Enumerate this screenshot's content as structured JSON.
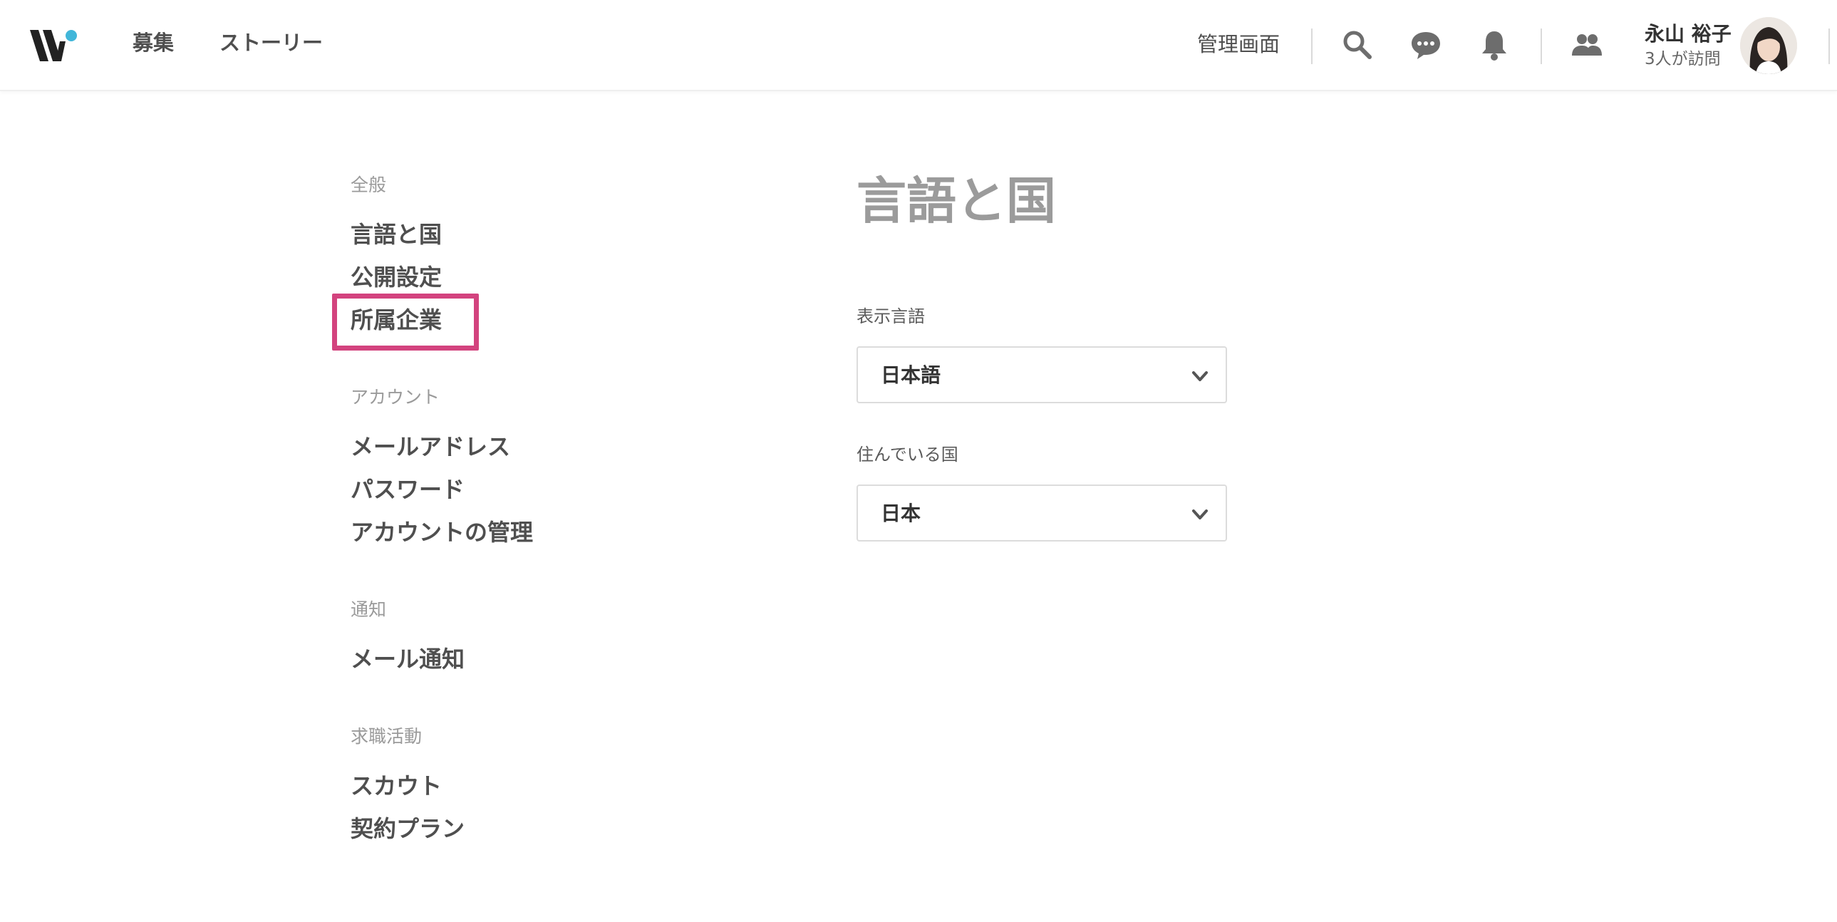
{
  "header": {
    "nav": [
      "募集",
      "ストーリー"
    ],
    "admin_label": "管理画面",
    "user_name": "永山 裕子",
    "user_visits": "3人が訪問",
    "brand_accent": "#41b6d9"
  },
  "sidebar": {
    "sections": [
      {
        "label": "全般",
        "items": [
          "言語と国",
          "公開設定",
          "所属企業"
        ]
      },
      {
        "label": "アカウント",
        "items": [
          "メールアドレス",
          "パスワード",
          "アカウントの管理"
        ]
      },
      {
        "label": "通知",
        "items": [
          "メール通知"
        ]
      },
      {
        "label": "求職活動",
        "items": [
          "スカウト",
          "契約プラン"
        ]
      }
    ],
    "highlight_color": "#d3437e"
  },
  "main": {
    "title": "言語と国",
    "fields": [
      {
        "label": "表示言語",
        "value": "日本語"
      },
      {
        "label": "住んでいる国",
        "value": "日本"
      }
    ]
  }
}
